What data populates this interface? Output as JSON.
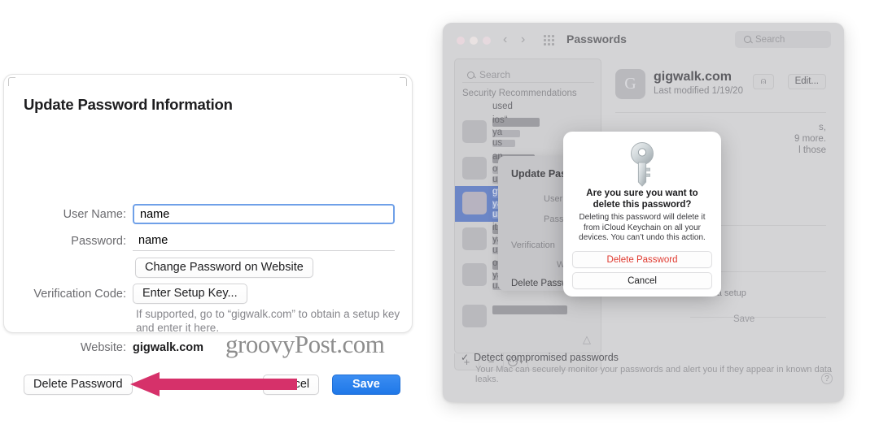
{
  "left_dialog": {
    "title": "Update Password Information",
    "fields": {
      "username_label": "User Name:",
      "username_value": "name",
      "password_label": "Password:",
      "password_value": "name",
      "change_password_button": "Change Password on Website",
      "verification_label": "Verification Code:",
      "setup_key_button": "Enter Setup Key...",
      "hint": "If supported, go to “gigwalk.com” to obtain a setup key and enter it here.",
      "website_label": "Website:",
      "website_value": "gigwalk.com"
    },
    "actions": {
      "delete": "Delete Password",
      "cancel": "Cancel",
      "save": "Save"
    },
    "watermark": "groovyPost.com",
    "arrow_color": "#d6316a"
  },
  "mac_window": {
    "title": "Passwords",
    "toolbar_search_placeholder": "Search",
    "nav_back_icon": "chevron-left-icon",
    "nav_forward_icon": "chevron-right-icon",
    "grid_icon": "grid-icon",
    "sidebar": {
      "search_placeholder": "Search",
      "section_header": "Security Recommendations",
      "rows": [
        {
          "frags": [
            "used"
          ],
          "selected": false
        },
        {
          "frags": [
            "ios“",
            "ya",
            "us"
          ],
          "selected": false
        },
        {
          "frags": [
            "an",
            "ot",
            "us"
          ],
          "selected": false
        },
        {
          "frags": [
            "gw",
            "ya",
            "us"
          ],
          "selected": true
        },
        {
          "frags": [
            "it.c",
            "ya",
            "us"
          ],
          "selected": false
        },
        {
          "frags": [
            "ob",
            "ya",
            "us"
          ],
          "selected": false
        },
        {
          "frags": [],
          "selected": false
        }
      ],
      "warning_icon": "warning-triangle-icon",
      "toolbar": {
        "add": "+",
        "remove": "−",
        "more": "⋯"
      }
    },
    "detail": {
      "avatar_letter": "G",
      "title": "gigwalk.com",
      "subtitle": "Last modified 1/19/20",
      "share_icon": "share-icon",
      "edit_button": "Edit...",
      "fragments": [
        "s,",
        "9 more.",
        "l those",
        "tain a setup",
        "Save"
      ]
    },
    "bottom": {
      "check_icon": "checkmark-icon",
      "label": "Detect compromised passwords",
      "sublabel": "Your Mac can securely monitor your passwords and alert you if they appear in known data leaks.",
      "help": "?"
    },
    "background_sheet": {
      "title": "Update Pass",
      "line1": "User",
      "line2": "Pass",
      "line3": "Verification",
      "line4": "We",
      "delete": "Delete Passw"
    }
  },
  "confirm_alert": {
    "icon": "key-icon",
    "title": "Are you sure you want to delete this password?",
    "body": "Deleting this password will delete it from iCloud Keychain on all your devices. You can’t undo this action.",
    "delete_button": "Delete Password",
    "cancel_button": "Cancel",
    "delete_color": "#e0392f"
  }
}
